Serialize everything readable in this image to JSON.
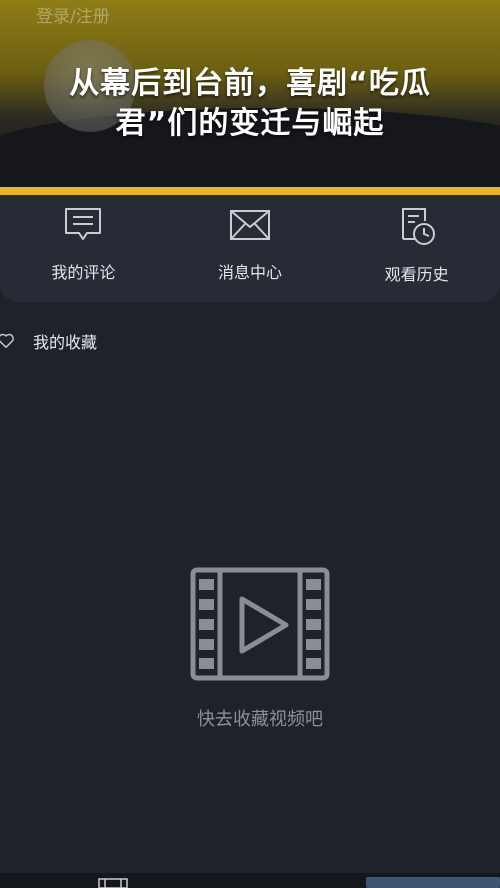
{
  "header": {
    "login_label": "登录/注册",
    "headline_line1": "从幕后到台前，喜剧“吃瓜",
    "headline_line2": "君”们的变迁与崛起"
  },
  "quick_actions": [
    {
      "label": "我的评论",
      "icon": "comment-icon"
    },
    {
      "label": "消息中心",
      "icon": "mail-icon"
    },
    {
      "label": "观看历史",
      "icon": "history-icon"
    }
  ],
  "favorites": {
    "title": "我的收藏",
    "icon": "heart-icon",
    "empty_text": "快去收藏视频吧",
    "empty_icon": "video-play-icon"
  },
  "colors": {
    "background": "#1e222b",
    "accent": "#e4b91f",
    "panel": "#262b35"
  }
}
